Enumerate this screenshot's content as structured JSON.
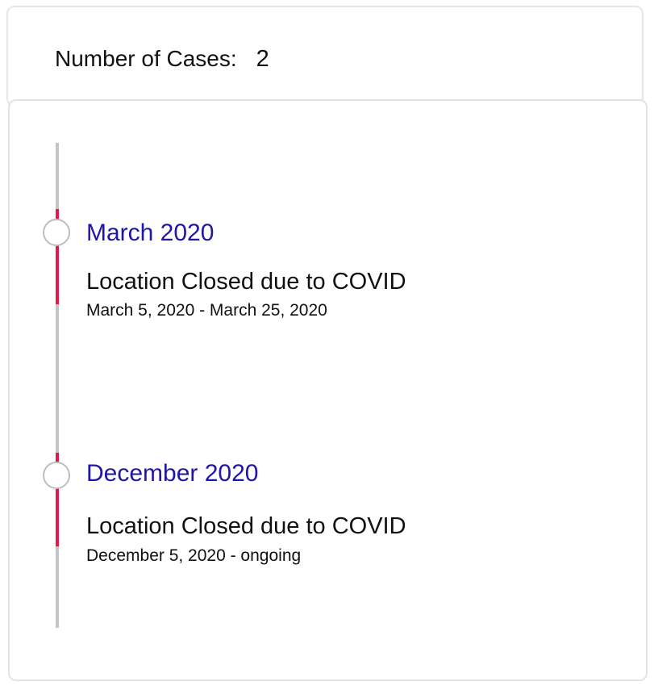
{
  "summary": {
    "label": "Number of Cases:",
    "value": "2"
  },
  "timeline": {
    "entries": [
      {
        "month": "March 2020",
        "title": "Location Closed due to COVID",
        "range": "March 5, 2020 - March 25, 2020"
      },
      {
        "month": "December 2020",
        "title": "Location Closed due to COVID",
        "range": "December 5, 2020 - ongoing"
      }
    ]
  },
  "colors": {
    "accent": "#e8174a",
    "month_text": "#1f15a8",
    "rail": "#c4c4c4"
  }
}
